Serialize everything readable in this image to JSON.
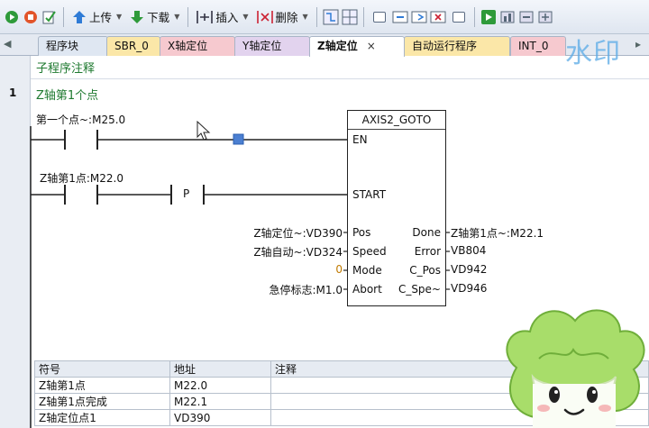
{
  "toolbar": {
    "upload_label": "上传",
    "download_label": "下载",
    "insert_label": "插入",
    "delete_label": "删除"
  },
  "tabs": [
    {
      "label": "程序块"
    },
    {
      "label": "SBR_0"
    },
    {
      "label": "X轴定位"
    },
    {
      "label": "Y轴定位"
    },
    {
      "label": "Z轴定位",
      "active": true,
      "close": "×"
    },
    {
      "label": "自动运行程序"
    },
    {
      "label": "INT_0"
    }
  ],
  "editor": {
    "subroutine_comment": "子程序注释",
    "rung": {
      "number": "1",
      "comment": "Z轴第1个点",
      "contact1": {
        "label": "第一个点~:M25.0"
      },
      "contact2": {
        "label": "Z轴第1点:M22.0"
      },
      "edge": "P"
    },
    "function_block": {
      "title": "AXIS2_GOTO",
      "inputs": {
        "en": "EN",
        "start": "START",
        "pos": "Pos",
        "speed": "Speed",
        "mode": "Mode",
        "abort": "Abort"
      },
      "outputs": {
        "done": "Done",
        "error": "Error",
        "c_pos": "C_Pos",
        "c_speed": "C_Spe~"
      },
      "input_operands": {
        "pos": "Z轴定位~:VD390",
        "speed": "Z轴自动~:VD324",
        "mode": "0",
        "abort": "急停标志:M1.0"
      },
      "output_operands": {
        "done": "Z轴第1点~:M22.1",
        "error": "VB804",
        "c_pos": "VD942",
        "c_speed": "VD946"
      }
    }
  },
  "symbol_table": {
    "headers": {
      "symbol": "符号",
      "address": "地址",
      "comment": "注释"
    },
    "rows": [
      {
        "symbol": "Z轴第1点",
        "address": "M22.0",
        "comment": ""
      },
      {
        "symbol": "Z轴第1点完成",
        "address": "M22.1",
        "comment": ""
      },
      {
        "symbol": "Z轴定位点1",
        "address": "VD390",
        "comment": ""
      }
    ]
  },
  "watermark": "水印",
  "colors": {
    "comment_green": "#1f7a30",
    "toolbar_bg": "#dfe6f0",
    "tab_colors": [
      "#dfe7f2",
      "#fbe7a8",
      "#f6c9cf",
      "#e2d3ee",
      "#ffffff",
      "#fbe7a8",
      "#f6c9cf"
    ]
  }
}
